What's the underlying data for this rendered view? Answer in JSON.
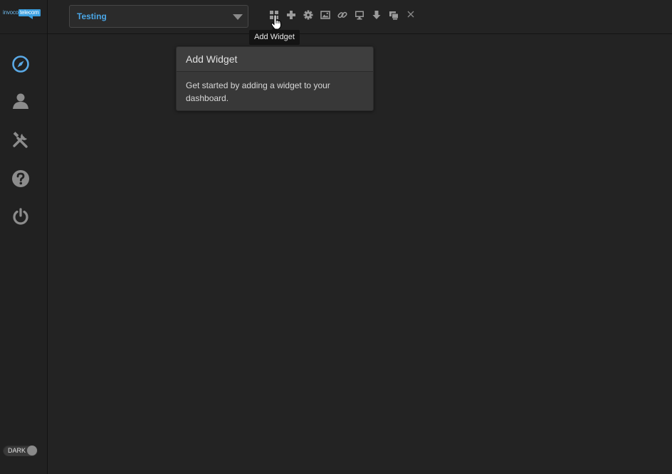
{
  "logo": {
    "part1": "invoco",
    "part2": "telecom"
  },
  "sidebar": {
    "items": [
      {
        "name": "compass-icon",
        "color": "#5aa9e6"
      },
      {
        "name": "user-icon",
        "color": "#8c8c8c"
      },
      {
        "name": "tools-icon",
        "color": "#8c8c8c"
      },
      {
        "name": "help-icon",
        "color": "#8c8c8c"
      },
      {
        "name": "power-icon",
        "color": "#8c8c8c"
      }
    ],
    "theme_toggle": {
      "label": "DARK"
    }
  },
  "header": {
    "dashboard_select": {
      "value": "Testing"
    },
    "toolbar": [
      "add-widget-icon",
      "plus-icon",
      "gear-icon",
      "image-icon",
      "link-icon",
      "monitor-icon",
      "download-icon",
      "screens-icon",
      "close-icon"
    ],
    "tooltip": "Add Widget"
  },
  "popover": {
    "title": "Add Widget",
    "body": "Get started by adding a widget to your dashboard."
  },
  "colors": {
    "accent": "#4aa6e6",
    "background": "#232323",
    "icon": "#8c8c8c"
  }
}
